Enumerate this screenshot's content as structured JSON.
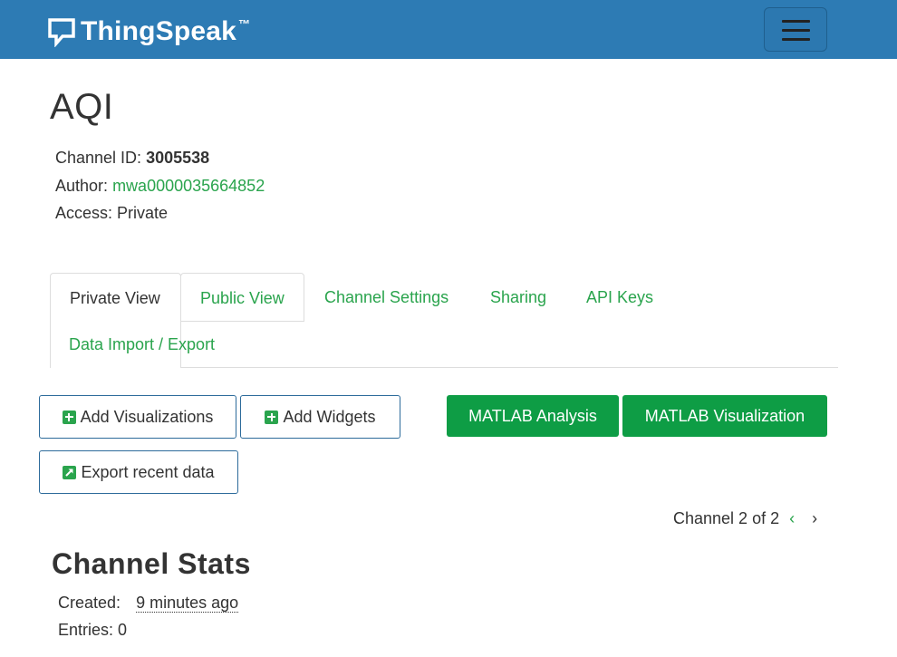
{
  "navbar": {
    "brand": "ThingSpeak",
    "trademark": "™",
    "menu_icon": "hamburger-menu-icon"
  },
  "channel": {
    "name": "AQI",
    "id_label": "Channel ID:",
    "id_value": "3005538",
    "author_label": "Author:",
    "author_value": "mwa0000035664852",
    "access_label": "Access:",
    "access_value": "Private"
  },
  "tabs": [
    {
      "label": "Private View",
      "active": true
    },
    {
      "label": "Public View",
      "active": false
    },
    {
      "label": "Channel Settings",
      "active": false
    },
    {
      "label": "Sharing",
      "active": false
    },
    {
      "label": "API Keys",
      "active": false
    },
    {
      "label": "Data Import / Export",
      "active": false
    }
  ],
  "buttons": {
    "add_visualizations": "Add Visualizations",
    "add_widgets": "Add Widgets",
    "matlab_analysis": "MATLAB Analysis",
    "matlab_visualization": "MATLAB Visualization",
    "export_recent": "Export recent data"
  },
  "pager": {
    "text": "Channel 2 of 2",
    "prev": "‹",
    "next": "›"
  },
  "stats": {
    "title": "Channel Stats",
    "created_label": "Created:",
    "created_value": "9 minutes ago",
    "entries_label": "Entries:",
    "entries_value": "0"
  },
  "colors": {
    "navbar": "#2d7bb4",
    "accent_green": "#2aa44d",
    "button_green": "#0e9d45"
  }
}
